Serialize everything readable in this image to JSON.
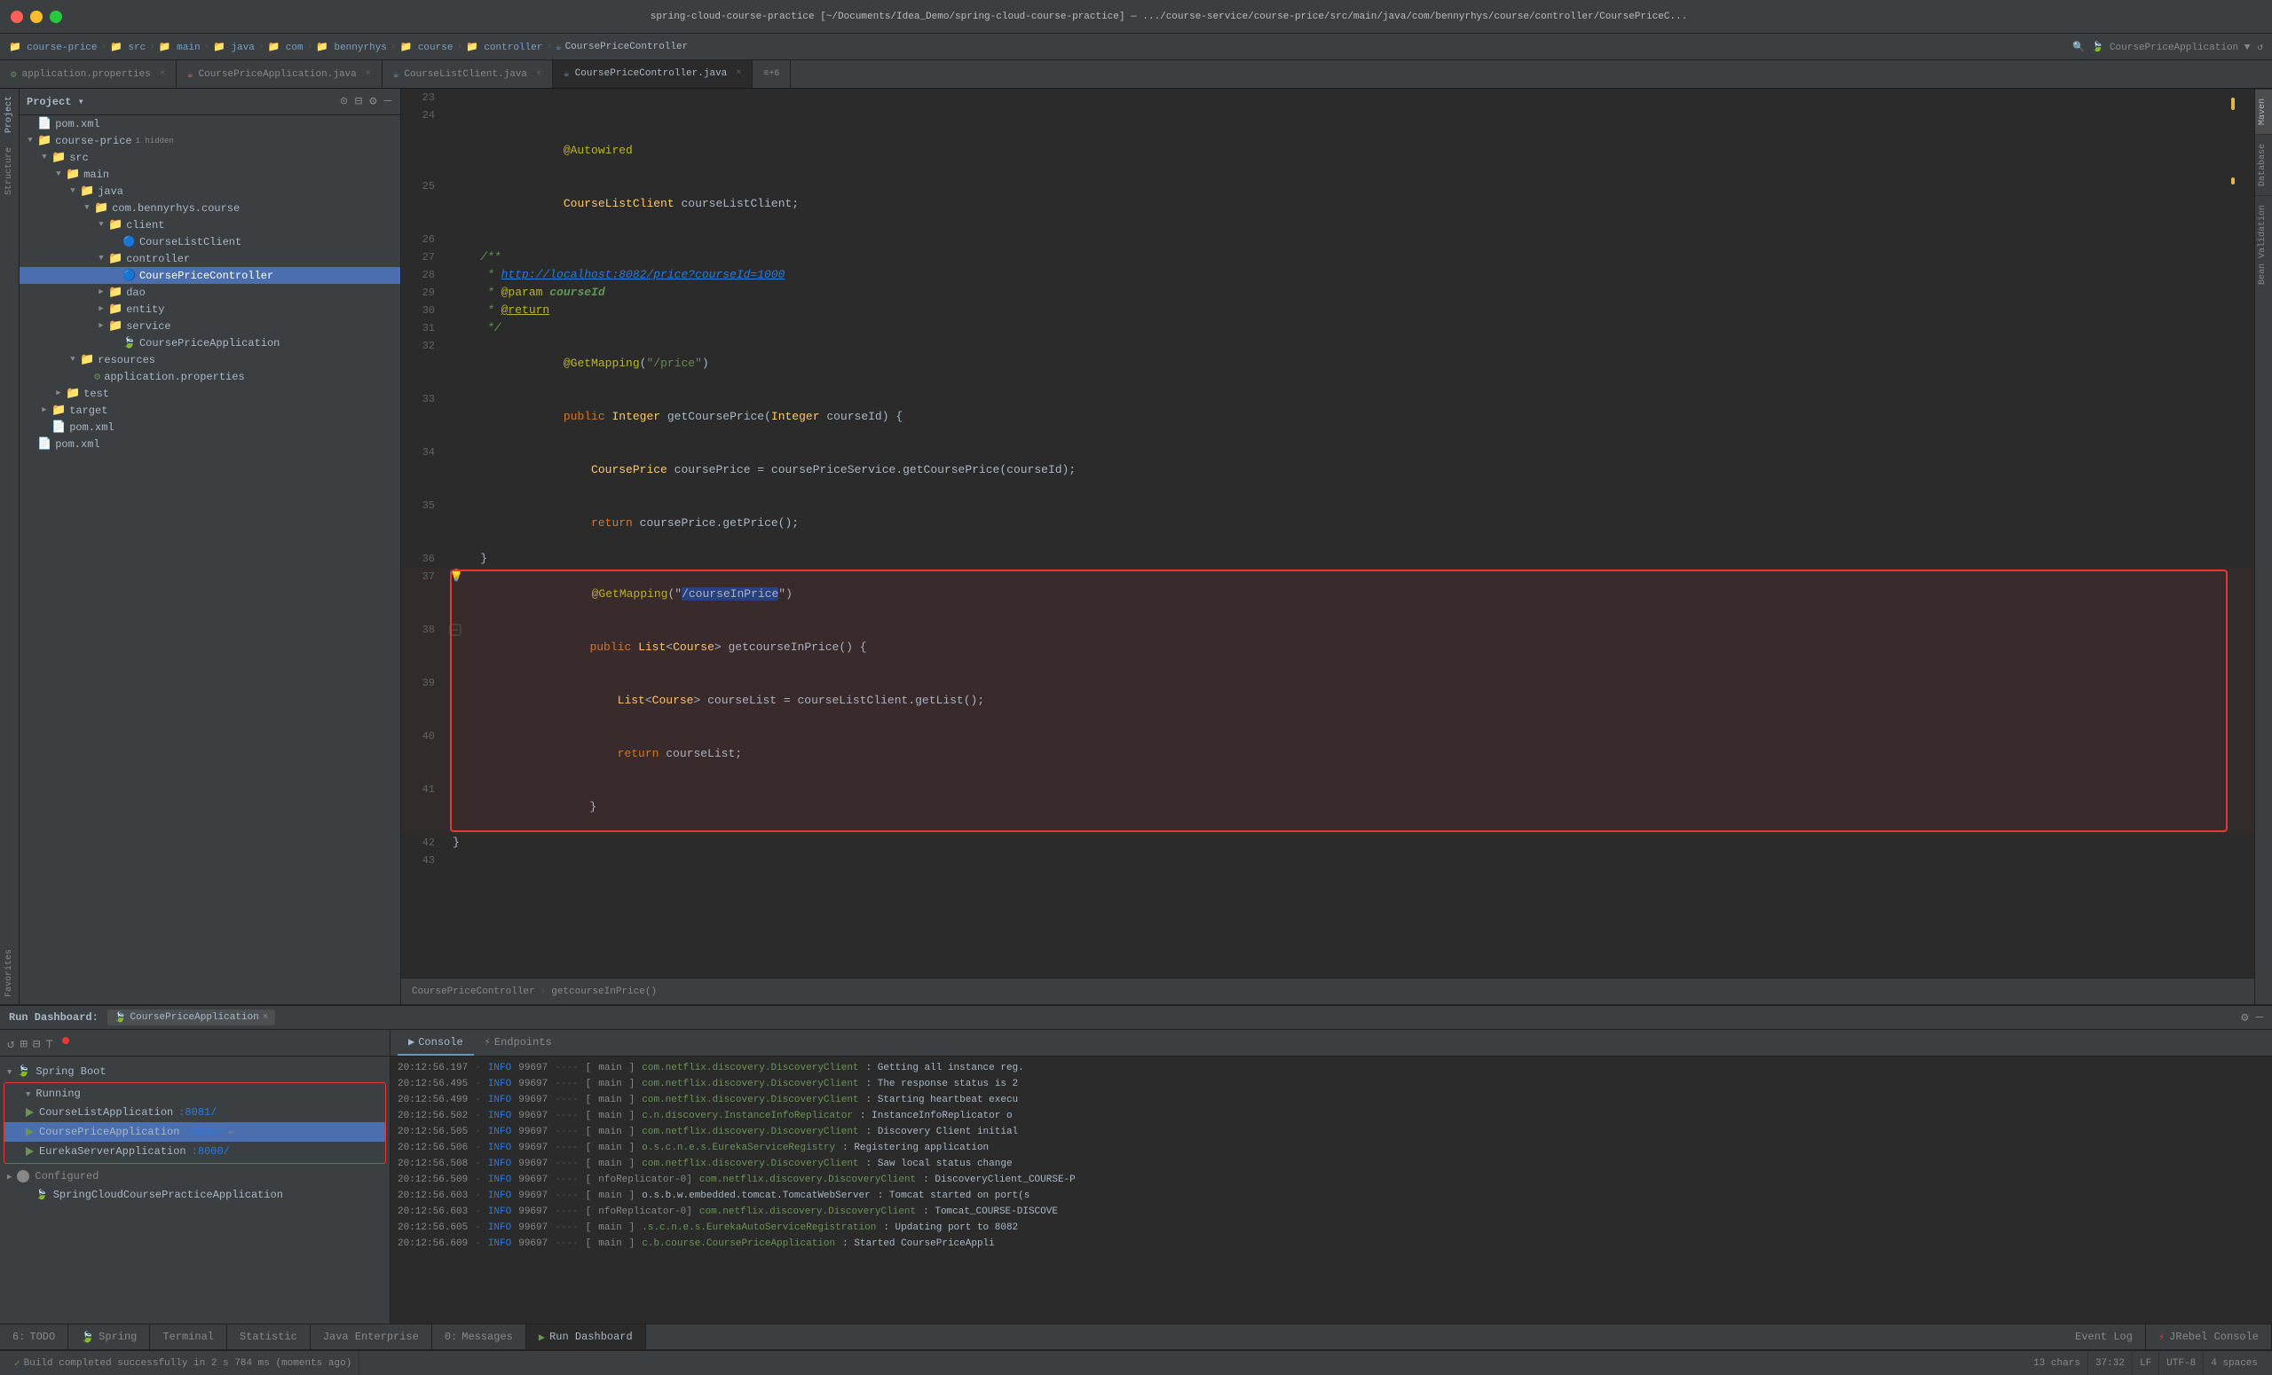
{
  "titlebar": {
    "text": "spring-cloud-course-practice [~/Documents/Idea_Demo/spring-cloud-course-practice] — .../course-service/course-price/src/main/java/com/bennyrhys/course/controller/CoursePriceC..."
  },
  "breadcrumb": {
    "items": [
      "course-price",
      "src",
      "main",
      "java",
      "com",
      "bennyrhys",
      "course",
      "controller",
      "CoursePriceController"
    ]
  },
  "tabs": [
    {
      "label": "application.properties",
      "type": "props",
      "active": false
    },
    {
      "label": "CoursePriceApplication.java",
      "type": "java",
      "active": false
    },
    {
      "label": "CourseListClient.java",
      "type": "java",
      "active": false
    },
    {
      "label": "CoursePriceController.java",
      "type": "java",
      "active": true
    },
    {
      "label": "+6",
      "type": "count",
      "active": false
    }
  ],
  "project_tree": {
    "title": "Project",
    "items": [
      {
        "level": 0,
        "label": "pom.xml",
        "icon": "xml",
        "arrow": "none"
      },
      {
        "level": 0,
        "label": "course-price",
        "icon": "folder",
        "arrow": "down",
        "badge": "1 hidden"
      },
      {
        "level": 1,
        "label": "src",
        "icon": "folder",
        "arrow": "down"
      },
      {
        "level": 2,
        "label": "main",
        "icon": "folder",
        "arrow": "down"
      },
      {
        "level": 3,
        "label": "java",
        "icon": "folder",
        "arrow": "down"
      },
      {
        "level": 4,
        "label": "com.bennyrhys.course",
        "icon": "folder",
        "arrow": "down"
      },
      {
        "level": 5,
        "label": "client",
        "icon": "folder",
        "arrow": "down"
      },
      {
        "level": 6,
        "label": "CourseListClient",
        "icon": "java",
        "arrow": "none"
      },
      {
        "level": 5,
        "label": "controller",
        "icon": "folder",
        "arrow": "down"
      },
      {
        "level": 6,
        "label": "CoursePriceController",
        "icon": "java",
        "arrow": "none",
        "selected": true
      },
      {
        "level": 5,
        "label": "dao",
        "icon": "folder",
        "arrow": "right"
      },
      {
        "level": 5,
        "label": "entity",
        "icon": "folder",
        "arrow": "right"
      },
      {
        "level": 5,
        "label": "service",
        "icon": "folder",
        "arrow": "right"
      },
      {
        "level": 6,
        "label": "CoursePriceApplication",
        "icon": "java",
        "arrow": "none"
      },
      {
        "level": 3,
        "label": "resources",
        "icon": "folder",
        "arrow": "down"
      },
      {
        "level": 4,
        "label": "application.properties",
        "icon": "properties",
        "arrow": "none"
      },
      {
        "level": 2,
        "label": "test",
        "icon": "folder",
        "arrow": "right"
      },
      {
        "level": 1,
        "label": "target",
        "icon": "folder",
        "arrow": "right"
      },
      {
        "level": 1,
        "label": "pom.xml",
        "icon": "xml",
        "arrow": "none"
      },
      {
        "level": 0,
        "label": "pom.xml",
        "icon": "xml",
        "arrow": "none"
      }
    ]
  },
  "code": {
    "lines": [
      {
        "num": 23,
        "content": "",
        "parts": []
      },
      {
        "num": 24,
        "content": "    @Autowired",
        "parts": [
          {
            "text": "    @Autowired",
            "cls": "ann"
          }
        ]
      },
      {
        "num": 25,
        "content": "    CourseListClient courseListClient;",
        "parts": [
          {
            "text": "    ",
            "cls": ""
          },
          {
            "text": "CourseListClient",
            "cls": "cls"
          },
          {
            "text": " courseListClient;",
            "cls": "var"
          }
        ]
      },
      {
        "num": 26,
        "content": "",
        "parts": []
      },
      {
        "num": 27,
        "content": "    /**",
        "parts": [
          {
            "text": "    /**",
            "cls": "comment"
          }
        ]
      },
      {
        "num": 28,
        "content": "     * http://localhost:8082/price?courseId=1000",
        "parts": [
          {
            "text": "     * ",
            "cls": "comment"
          },
          {
            "text": "http://localhost:8082/price?courseId=1000",
            "cls": "link comment"
          }
        ]
      },
      {
        "num": 29,
        "content": "     * @param courseId",
        "parts": [
          {
            "text": "     * ",
            "cls": "comment"
          },
          {
            "text": "@param",
            "cls": "ann"
          },
          {
            "text": " courseId",
            "cls": "comment"
          }
        ]
      },
      {
        "num": 30,
        "content": "     * @return",
        "parts": [
          {
            "text": "     * ",
            "cls": "comment"
          },
          {
            "text": "@return",
            "cls": "ann"
          }
        ]
      },
      {
        "num": 31,
        "content": "     */",
        "parts": [
          {
            "text": "     */",
            "cls": "comment"
          }
        ]
      },
      {
        "num": 32,
        "content": "    @GetMapping(\"/price\")",
        "parts": [
          {
            "text": "    ",
            "cls": ""
          },
          {
            "text": "@GetMapping",
            "cls": "ann"
          },
          {
            "text": "(",
            "cls": ""
          },
          {
            "text": "\"/price\"",
            "cls": "str"
          },
          {
            "text": ")",
            "cls": ""
          }
        ]
      },
      {
        "num": 33,
        "content": "    public Integer getCoursePrice(Integer courseId) {",
        "parts": [
          {
            "text": "    ",
            "cls": ""
          },
          {
            "text": "public",
            "cls": "kw"
          },
          {
            "text": " ",
            "cls": ""
          },
          {
            "text": "Integer",
            "cls": "cls"
          },
          {
            "text": " getCoursePrice(",
            "cls": ""
          },
          {
            "text": "Integer",
            "cls": "cls"
          },
          {
            "text": " courseId) {",
            "cls": ""
          }
        ]
      },
      {
        "num": 34,
        "content": "        CoursePrice coursePrice = coursePriceService.getCoursePrice(courseId);",
        "parts": [
          {
            "text": "        ",
            "cls": ""
          },
          {
            "text": "CoursePrice",
            "cls": "cls"
          },
          {
            "text": " coursePrice = coursePriceService.getCoursePrice(courseId);",
            "cls": ""
          }
        ]
      },
      {
        "num": 35,
        "content": "        return coursePrice.getPrice();",
        "parts": [
          {
            "text": "        ",
            "cls": ""
          },
          {
            "text": "return",
            "cls": "kw"
          },
          {
            "text": " coursePrice.getPrice();",
            "cls": ""
          }
        ]
      },
      {
        "num": 36,
        "content": "    }",
        "parts": [
          {
            "text": "    }",
            "cls": ""
          }
        ]
      },
      {
        "num": 37,
        "content": "    @GetMapping(\"/courseInPrice\")",
        "highlight": true,
        "parts": [
          {
            "text": "    ",
            "cls": ""
          },
          {
            "text": "@GetMapping",
            "cls": "ann"
          },
          {
            "text": "(\"",
            "cls": ""
          },
          {
            "text": "/courseInPrice",
            "cls": "sel-text str"
          },
          {
            "text": "\")",
            "cls": ""
          }
        ]
      },
      {
        "num": 38,
        "content": "    public List<Course> getcourseInPrice() {",
        "highlight": true,
        "parts": [
          {
            "text": "    ",
            "cls": ""
          },
          {
            "text": "public",
            "cls": "kw"
          },
          {
            "text": " ",
            "cls": ""
          },
          {
            "text": "List",
            "cls": "cls"
          },
          {
            "text": "<",
            "cls": ""
          },
          {
            "text": "Course",
            "cls": "cls"
          },
          {
            "text": "> getcourseInPrice() {",
            "cls": ""
          }
        ]
      },
      {
        "num": 39,
        "content": "        List<Course> courseList = courseListClient.getList();",
        "highlight": true,
        "parts": [
          {
            "text": "        ",
            "cls": ""
          },
          {
            "text": "List",
            "cls": "cls"
          },
          {
            "text": "<",
            "cls": ""
          },
          {
            "text": "Course",
            "cls": "cls"
          },
          {
            "text": "> courseList = courseListClient.getList();",
            "cls": ""
          }
        ]
      },
      {
        "num": 40,
        "content": "        return courseList;",
        "highlight": true,
        "parts": [
          {
            "text": "        ",
            "cls": ""
          },
          {
            "text": "return",
            "cls": "kw"
          },
          {
            "text": " courseList;",
            "cls": ""
          }
        ]
      },
      {
        "num": 41,
        "content": "    }",
        "highlight": true,
        "parts": [
          {
            "text": "    }",
            "cls": ""
          }
        ]
      },
      {
        "num": 42,
        "content": "}",
        "parts": [
          {
            "text": "}",
            "cls": ""
          }
        ]
      },
      {
        "num": 43,
        "content": "",
        "parts": []
      }
    ]
  },
  "editor_breadcrumb": {
    "path": "CoursePriceController",
    "method": "getcourseInPrice()"
  },
  "run_dashboard": {
    "title": "Run Dashboard:",
    "app": "CoursePriceApplication",
    "sections": {
      "spring_boot": {
        "label": "Spring Boot",
        "subsection": "Running",
        "apps": [
          {
            "name": "CourseListApplication",
            "port": ":8081/",
            "selected": false
          },
          {
            "name": "CoursePriceApplication",
            "port": ":8082/",
            "selected": true
          },
          {
            "name": "EurekaServerApplication",
            "port": ":8000/",
            "selected": false
          }
        ],
        "configured": "Configured",
        "configured_apps": [
          {
            "name": "SpringCloudCoursePracticeApplication",
            "selected": false
          }
        ]
      }
    }
  },
  "console": {
    "tabs": [
      "Console",
      "Endpoints"
    ],
    "active_tab": "Console",
    "lines": [
      {
        "time": "20:12:56.197",
        "dash": "—",
        "level": "INFO",
        "pid": "99697",
        "sep": "----",
        "bracket": "[",
        "thread": "main",
        "bracket2": "]",
        "cls": "com.netflix.discovery.DiscoveryClient",
        "msg": ": Getting all instance reg."
      },
      {
        "time": "20:12:56.495",
        "dash": "—",
        "level": "INFO",
        "pid": "99697",
        "sep": "----",
        "bracket": "[",
        "thread": "main",
        "bracket2": "]",
        "cls": "com.netflix.discovery.DiscoveryClient",
        "msg": ": The response status is 2"
      },
      {
        "time": "20:12:56.499",
        "dash": "—",
        "level": "INFO",
        "pid": "99697",
        "sep": "----",
        "bracket": "[",
        "thread": "main",
        "bracket2": "]",
        "cls": "com.netflix.discovery.DiscoveryClient",
        "msg": ": Starting heartbeat execu"
      },
      {
        "time": "20:12:56.502",
        "dash": "—",
        "level": "INFO",
        "pid": "99697",
        "sep": "----",
        "bracket": "[",
        "thread": "main",
        "bracket2": "]",
        "cls": "c.n.discovery.InstanceInfoReplicator",
        "msg": ": InstanceInfoReplicator o"
      },
      {
        "time": "20:12:56.505",
        "dash": "—",
        "level": "INFO",
        "pid": "99697",
        "sep": "----",
        "bracket": "[",
        "thread": "main",
        "bracket2": "]",
        "cls": "com.netflix.discovery.DiscoveryClient",
        "msg": ": Discovery Client initial"
      },
      {
        "time": "20:12:56.506",
        "dash": "—",
        "level": "INFO",
        "pid": "99697",
        "sep": "----",
        "bracket": "[",
        "thread": "main",
        "bracket2": "]",
        "cls": "o.s.c.n.e.s.EurekaServiceRegistry",
        "msg": ": Registering application"
      },
      {
        "time": "20:12:56.508",
        "dash": "—",
        "level": "INFO",
        "pid": "99697",
        "sep": "----",
        "bracket": "[",
        "thread": "main",
        "bracket2": "]",
        "cls": "com.netflix.discovery.DiscoveryClient",
        "msg": ": Saw local status change"
      },
      {
        "time": "20:12:56.509",
        "dash": "—",
        "level": "INFO",
        "pid": "99697",
        "sep": "----",
        "bracket": "[",
        "thread": "nfoReplicator-0]",
        "bracket2": "",
        "cls": "com.netflix.discovery.DiscoveryClient",
        "msg": ": DiscoveryClient_COURSE-P"
      },
      {
        "time": "20:12:56.603",
        "dash": "—",
        "level": "INFO",
        "pid": "99697",
        "sep": "----",
        "bracket": "[",
        "thread": "main",
        "bracket2": "]",
        "cls": "o.s.b.w.embedded.tomcat.TomcatWebServer",
        "msg": ": Tomcat started on port(s"
      },
      {
        "time": "20:12:56.603",
        "dash": "—",
        "level": "INFO",
        "pid": "99697",
        "sep": "----",
        "bracket": "[",
        "thread": "nfoReplicator-0]",
        "bracket2": "",
        "cls": "com.netflix.discovery.DiscoveryClient",
        "msg": ": Tomcat_COURSE-DISCOVE"
      },
      {
        "time": "20:12:56.605",
        "dash": "—",
        "level": "INFO",
        "pid": "99697",
        "sep": "----",
        "bracket": "[",
        "thread": "main",
        "bracket2": "]",
        "cls": ".s.c.n.e.s.EurekaAutoServiceRegistration",
        "msg": ": Updating port to 8082"
      },
      {
        "time": "20:12:56.609",
        "dash": "—",
        "level": "INFO",
        "pid": "99697",
        "sep": "----",
        "bracket": "[",
        "thread": "main",
        "bracket2": "]",
        "cls": "c.b.course.CoursePriceApplication",
        "msg": ": Started CoursePriceAppli"
      }
    ]
  },
  "bottom_tabs": [
    {
      "label": "6: TODO",
      "num": "6",
      "active": false
    },
    {
      "label": "Spring",
      "active": false
    },
    {
      "label": "Terminal",
      "active": false
    },
    {
      "label": "Statistic",
      "active": false
    },
    {
      "label": "Java Enterprise",
      "active": false
    },
    {
      "label": "0: Messages",
      "num": "0",
      "active": false
    },
    {
      "label": "Run Dashboard",
      "active": true
    }
  ],
  "right_tabs": [
    {
      "label": "Maven"
    },
    {
      "label": "Database"
    },
    {
      "label": "Bean Validation"
    }
  ],
  "statusbar": {
    "build_msg": "Build completed successfully in 2 s 784 ms (moments ago)",
    "chars": "13 chars",
    "position": "37:32",
    "lf": "LF",
    "encoding": "UTF-8",
    "indent": "4 spaces",
    "event_log": "Event Log",
    "jrebel": "JRebel Console"
  }
}
